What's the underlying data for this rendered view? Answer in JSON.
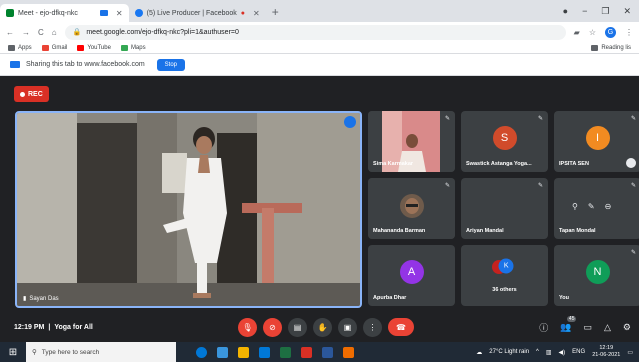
{
  "browser": {
    "tabs": [
      {
        "title": "Meet - ejo-dfkq-nkc",
        "active": true
      },
      {
        "title": "(5) Live Producer | Facebook",
        "active": false
      }
    ],
    "url": "meet.google.com/ejo-dfkq-nkc?pli=1&authuser=0",
    "profile_initial": "G",
    "bookmarks": [
      {
        "label": "Apps",
        "color": "#5f6368"
      },
      {
        "label": "Gmail",
        "color": "#ea4335"
      },
      {
        "label": "YouTube",
        "color": "#ff0000"
      },
      {
        "label": "Maps",
        "color": "#34a853"
      }
    ],
    "reading_list": "Reading lis",
    "share_text": "Sharing this tab to www.facebook.com",
    "stop_label": "Stop"
  },
  "meet": {
    "rec_label": "REC",
    "main_speaker": "Sayan Das",
    "participants": [
      {
        "name": "Sima Karmakar",
        "avatar": "",
        "color": "",
        "photo": true
      },
      {
        "name": "Swastick Astanga Yoga...",
        "avatar": "S",
        "color": "#d14b2b"
      },
      {
        "name": "IPSITA SEN",
        "avatar": "I",
        "color": "#f28b21"
      },
      {
        "name": "Mahananda Barman",
        "avatar": "",
        "color": "",
        "photo": true
      },
      {
        "name": "Ariyan Mandal",
        "avatar": "",
        "color": ""
      },
      {
        "name": "Tapan Mondal",
        "avatar": "",
        "color": ""
      },
      {
        "name": "Apurba Dhar",
        "avatar": "A",
        "color": "#9334e6"
      },
      {
        "name": "36 others",
        "avatar": "K",
        "color": "#1a73e8"
      },
      {
        "name": "You",
        "avatar": "N",
        "color": "#0f9d58"
      }
    ],
    "time": "12:19 PM",
    "separator": "|",
    "meeting_name": "Yoga for All",
    "people_count": "45"
  },
  "taskbar": {
    "search_placeholder": "Type here to search",
    "weather": "27°C  Light rain",
    "lang": "ENG",
    "time": "12:19",
    "date": "21-06-2021"
  }
}
